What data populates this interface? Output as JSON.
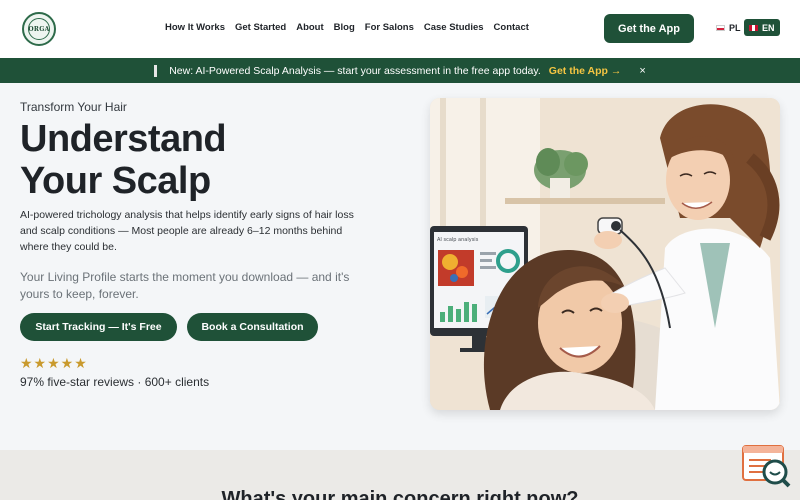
{
  "brand": {
    "logo_text": "ORGA"
  },
  "nav": {
    "items": [
      "How It Works",
      "Get Started",
      "About",
      "Blog",
      "For Salons",
      "Case Studies",
      "Contact"
    ],
    "cta_label": "Get the App"
  },
  "languages": {
    "pl": "PL",
    "en": "EN",
    "selected": "EN"
  },
  "banner": {
    "text": "New: AI-Powered Scalp Analysis — start your assessment in the free app today.",
    "cta": "Get the App →",
    "close": "×"
  },
  "hero": {
    "eyebrow": "Transform Your Hair",
    "title_line1": "Understand",
    "title_line2": "Your Scalp",
    "description": "AI-powered trichology analysis that helps identify early signs of hair loss and scalp conditions — Most people are already 6–12 months behind where they could be.",
    "subtext": "Your Living Profile starts the moment you download — and it's yours to keep, forever.",
    "primary_button": "Start Tracking — It's Free",
    "secondary_button": "Book a Consultation",
    "stars": "★★★★★",
    "rating_value": 5,
    "reviews": "97% five-star reviews · 600+ clients"
  },
  "monitor": {
    "title": "AI scalp analysis"
  },
  "section": {
    "heading": "What's your main concern right now?"
  },
  "colors": {
    "primary": "#1f5138",
    "accent": "#f5c542",
    "star": "#c99a2e"
  },
  "icons": {
    "chat": "chat-search-icon",
    "close": "close-icon"
  }
}
